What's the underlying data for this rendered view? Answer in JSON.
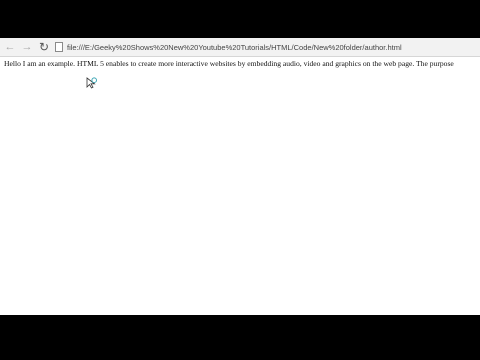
{
  "browser": {
    "address_url": "file:///E:/Geeky%20Shows%20New%20Youtube%20Tutorials/HTML/Code/New%20folder/author.html",
    "back_icon": "back-arrow-icon",
    "forward_icon": "forward-arrow-icon",
    "reload_icon": "reload-icon",
    "page_icon": "page-icon"
  },
  "page": {
    "body_text": "Hello I am an example. HTML 5 enables to create more interactive websites by embedding audio, video and graphics on the web page. The purpose"
  },
  "colors": {
    "letterbox": "#000000",
    "page_background": "#ffffff",
    "toolbar_background": "#f2f2f2"
  }
}
